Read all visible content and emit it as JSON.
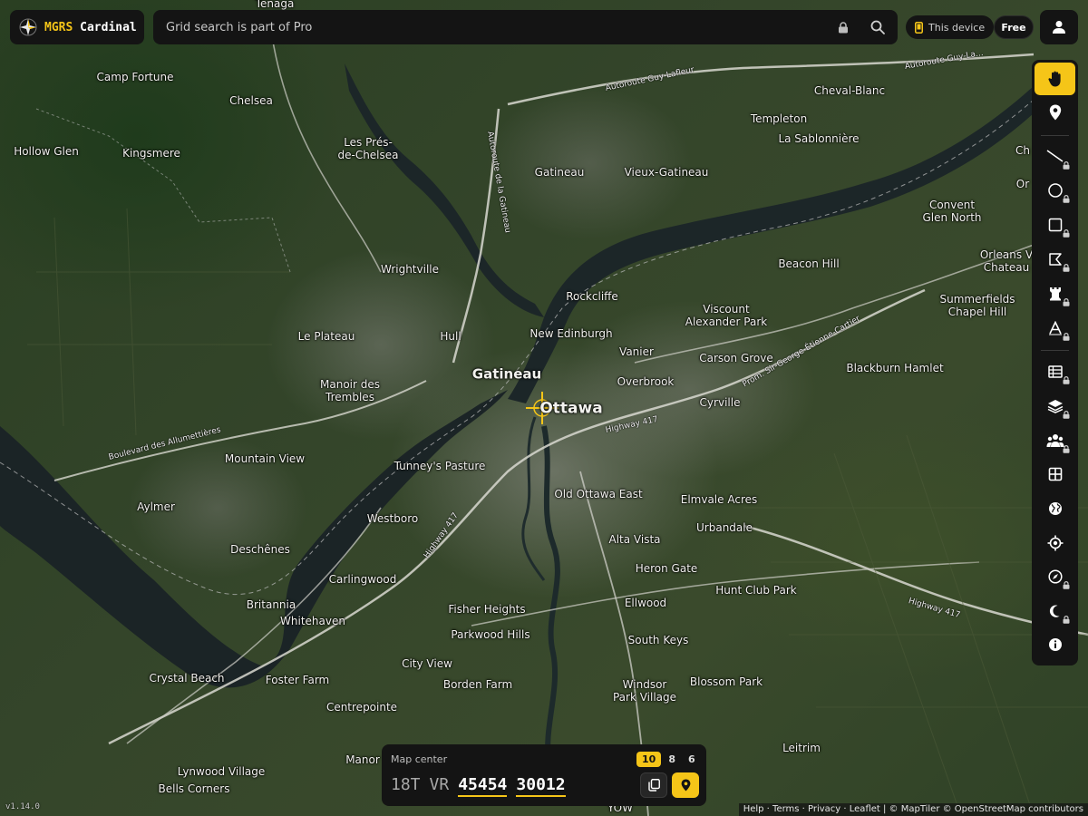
{
  "app": {
    "title_prefix": "MGRS",
    "title_suffix": "Cardinal",
    "logo_icon": "compass-star-icon",
    "version": "v1.14.0"
  },
  "search": {
    "placeholder": "Grid search is part of Pro",
    "lock_icon": "lock-icon",
    "search_icon": "search-icon"
  },
  "header": {
    "device_label": "This device",
    "device_icon": "phone-icon",
    "plan_badge": "Free",
    "user_icon": "user-icon"
  },
  "toolbar": {
    "items": [
      {
        "name": "pan",
        "icon": "hand-icon",
        "active": true,
        "locked": false
      },
      {
        "name": "marker",
        "icon": "map-pin-icon",
        "active": false,
        "locked": false
      },
      {
        "name": "line",
        "icon": "line-icon",
        "active": false,
        "locked": true
      },
      {
        "name": "circle",
        "icon": "circle-icon",
        "active": false,
        "locked": true
      },
      {
        "name": "rectangle",
        "icon": "square-icon",
        "active": false,
        "locked": true
      },
      {
        "name": "polygon",
        "icon": "polygon-icon",
        "active": false,
        "locked": true
      },
      {
        "name": "tower",
        "icon": "rook-icon",
        "active": false,
        "locked": true
      },
      {
        "name": "label",
        "icon": "text-icon",
        "active": false,
        "locked": true
      },
      {
        "name": "table",
        "icon": "table-icon",
        "active": false,
        "locked": true
      },
      {
        "name": "layers",
        "icon": "layers-icon",
        "active": false,
        "locked": true
      },
      {
        "name": "team",
        "icon": "users-icon",
        "active": false,
        "locked": true
      },
      {
        "name": "grid",
        "icon": "grid-icon",
        "active": false,
        "locked": false
      },
      {
        "name": "globe",
        "icon": "globe-icon",
        "active": false,
        "locked": false
      },
      {
        "name": "locate",
        "icon": "crosshair-icon",
        "active": false,
        "locked": false
      },
      {
        "name": "compass",
        "icon": "compass-icon",
        "active": false,
        "locked": true
      },
      {
        "name": "night",
        "icon": "moon-icon",
        "active": false,
        "locked": true
      },
      {
        "name": "info",
        "icon": "info-icon",
        "active": false,
        "locked": false
      }
    ]
  },
  "map_center": {
    "label": "Map center",
    "precision_options": [
      "10",
      "8",
      "6"
    ],
    "selected_precision": "10",
    "zone": "18T",
    "square": "VR",
    "easting": "45454",
    "northing": "30012",
    "copy_icon": "copy-icon",
    "pin_icon": "map-pin-icon"
  },
  "attribution": "Help · Terms · Privacy · Leaflet | © MapTiler © OpenStreetMap contributors",
  "places": [
    {
      "text": "Tenaga"
    },
    {
      "text": "Camp Fortune"
    },
    {
      "text": "Chelsea"
    },
    {
      "text": "Hollow Glen"
    },
    {
      "text": "Kingsmere"
    },
    {
      "text": "Les Prés-\nde-Chelsea"
    },
    {
      "text": "Gatineau"
    },
    {
      "text": "Vieux-Gatineau"
    },
    {
      "text": "Templeton"
    },
    {
      "text": "Cheval-Blanc"
    },
    {
      "text": "La Sablonnière"
    },
    {
      "text": "Wrightville"
    },
    {
      "text": "Rockcliffe"
    },
    {
      "text": "Beacon Hill"
    },
    {
      "text": "Convent\nGlen North"
    },
    {
      "text": "Orleans V\nChateau"
    },
    {
      "text": "Summerfields\nChapel Hill"
    },
    {
      "text": "Viscount\nAlexander Park"
    },
    {
      "text": "Le Plateau"
    },
    {
      "text": "Hull"
    },
    {
      "text": "New Edinburgh"
    },
    {
      "text": "Vanier"
    },
    {
      "text": "Carson Grove"
    },
    {
      "text": "Blackburn Hamlet"
    },
    {
      "text": "Gatineau"
    },
    {
      "text": "Ottawa"
    },
    {
      "text": "Manoir des\nTrembles"
    },
    {
      "text": "Overbrook"
    },
    {
      "text": "Cyrville"
    },
    {
      "text": "Mountain View"
    },
    {
      "text": "Tunney's Pasture"
    },
    {
      "text": "Old Ottawa East"
    },
    {
      "text": "Elmvale Acres"
    },
    {
      "text": "Aylmer"
    },
    {
      "text": "Westboro"
    },
    {
      "text": "Urbandale"
    },
    {
      "text": "Deschênes"
    },
    {
      "text": "Alta Vista"
    },
    {
      "text": "Carlingwood"
    },
    {
      "text": "Heron Gate"
    },
    {
      "text": "Hunt Club Park"
    },
    {
      "text": "Britannia"
    },
    {
      "text": "Ellwood"
    },
    {
      "text": "Fisher Heights"
    },
    {
      "text": "Whitehaven"
    },
    {
      "text": "Parkwood Hills"
    },
    {
      "text": "South Keys"
    },
    {
      "text": "City View"
    },
    {
      "text": "Crystal Beach"
    },
    {
      "text": "Foster Farm"
    },
    {
      "text": "Borden Farm"
    },
    {
      "text": "Blossom Park"
    },
    {
      "text": "Windsor\nPark Village"
    },
    {
      "text": "Centrepointe"
    },
    {
      "text": "Leitrim"
    },
    {
      "text": "Lynwood Village"
    },
    {
      "text": "Manor"
    },
    {
      "text": "Bells Corners"
    },
    {
      "text": "Ch"
    },
    {
      "text": "Or"
    },
    {
      "text": "YOW"
    }
  ],
  "roads": [
    {
      "text": "Autoroute Guy-Lafleur"
    },
    {
      "text": "Autoroute Guy-La..."
    },
    {
      "text": "Autoroute de la Gatineau"
    },
    {
      "text": "Boulevard des Allumettières"
    },
    {
      "text": "Highway 417"
    },
    {
      "text": "Highway 417"
    },
    {
      "text": "Prom. Sir-George-Étienne-Cartier"
    },
    {
      "text": "Highway 417"
    }
  ]
}
